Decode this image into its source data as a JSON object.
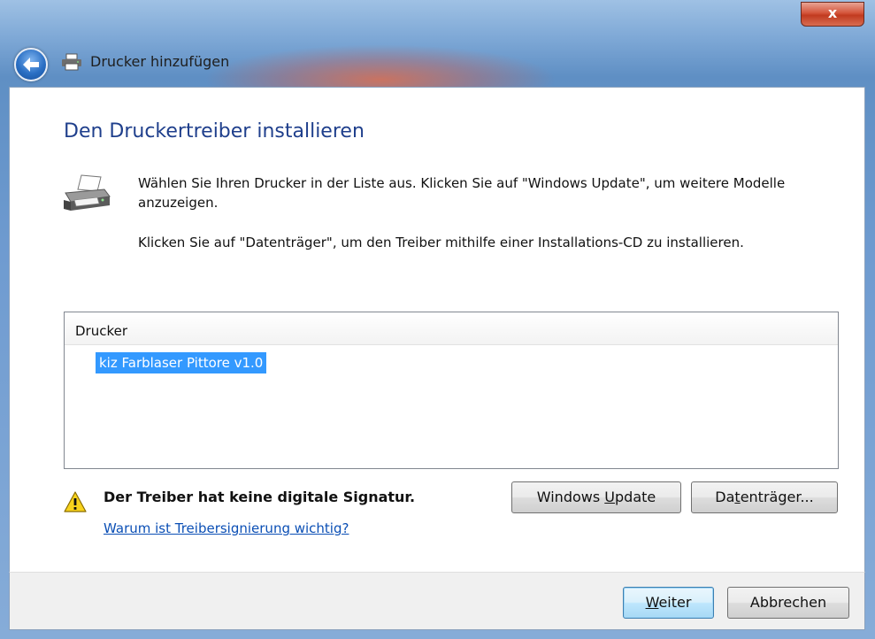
{
  "window": {
    "title": "Drucker hinzufügen",
    "close_label": "x"
  },
  "page": {
    "heading": "Den Druckertreiber installieren",
    "instruction_1": "Wählen Sie Ihren Drucker in der Liste aus. Klicken Sie auf \"Windows Update\", um weitere Modelle anzuzeigen.",
    "instruction_2": "Klicken Sie auf \"Datenträger\", um den Treiber mithilfe einer Installations-CD zu installieren."
  },
  "printer_list": {
    "column_header": "Drucker",
    "items": [
      "kiz Farblaser Pittore v1.0"
    ],
    "selected_index": 0
  },
  "signature_warning": {
    "text": "Der Treiber hat keine digitale Signatur.",
    "link": "Warum ist Treibersignierung wichtig?"
  },
  "buttons": {
    "windows_update": {
      "pre": "Windows ",
      "accel": "U",
      "post": "pdate"
    },
    "disk": {
      "pre": "Da",
      "accel": "t",
      "post": "enträger..."
    },
    "next": {
      "pre": "",
      "accel": "W",
      "post": "eiter"
    },
    "cancel": "Abbrechen"
  },
  "icons": {
    "back": "back-arrow-icon",
    "printer_small": "printer-icon",
    "printer_large": "printer-icon",
    "warning": "warning-icon"
  },
  "colors": {
    "heading": "#1f3f8c",
    "selection": "#3399ff",
    "link": "#0b4fb5",
    "close_button": "#c13b20"
  }
}
